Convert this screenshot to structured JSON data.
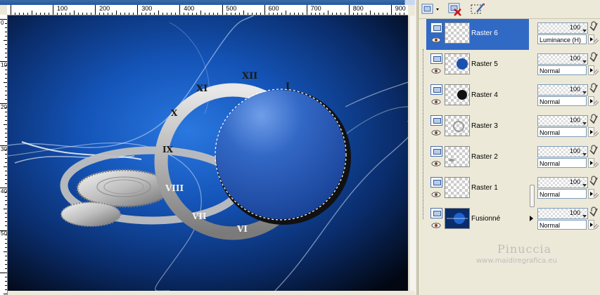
{
  "rulers": {
    "horizontal_labels": [
      "100",
      "200",
      "300",
      "400",
      "500",
      "600",
      "700",
      "800",
      "900"
    ],
    "vertical_labels": [
      "0",
      "100",
      "200",
      "300",
      "400",
      "500"
    ]
  },
  "canvas": {
    "roman_numerals": [
      "XII",
      "I",
      "XI",
      "X",
      "IX",
      "VIII",
      "VII",
      "VI"
    ]
  },
  "layers": [
    {
      "name": "Raster 6",
      "selected": true,
      "thumb": "empty",
      "opacity": "100",
      "blend": "Luminance (H)"
    },
    {
      "name": "Raster 5",
      "selected": false,
      "thumb": "blue-circle",
      "opacity": "100",
      "blend": "Normal"
    },
    {
      "name": "Raster 4",
      "selected": false,
      "thumb": "black-circle",
      "opacity": "100",
      "blend": "Normal"
    },
    {
      "name": "Raster 3",
      "selected": false,
      "thumb": "ring",
      "opacity": "100",
      "blend": "Normal"
    },
    {
      "name": "Raster 2",
      "selected": false,
      "thumb": "gear",
      "opacity": "100",
      "blend": "Normal"
    },
    {
      "name": "Raster 1",
      "selected": false,
      "thumb": "empty",
      "opacity": "100",
      "blend": "Normal"
    },
    {
      "name": "Fusionné",
      "selected": false,
      "thumb": "background",
      "opacity": "100",
      "blend": "Normal"
    }
  ],
  "toolbar": {
    "icons": [
      "new-layer-icon",
      "delete-layer-icon",
      "edit-selection-icon"
    ]
  },
  "watermark": {
    "name": "Pinuccia",
    "url": "www.maidiregrafica.eu"
  },
  "colors": {
    "selected_row": "#316ac5",
    "panel_bg": "#ece9d8",
    "canvas_blue": "#1a5fc8"
  }
}
